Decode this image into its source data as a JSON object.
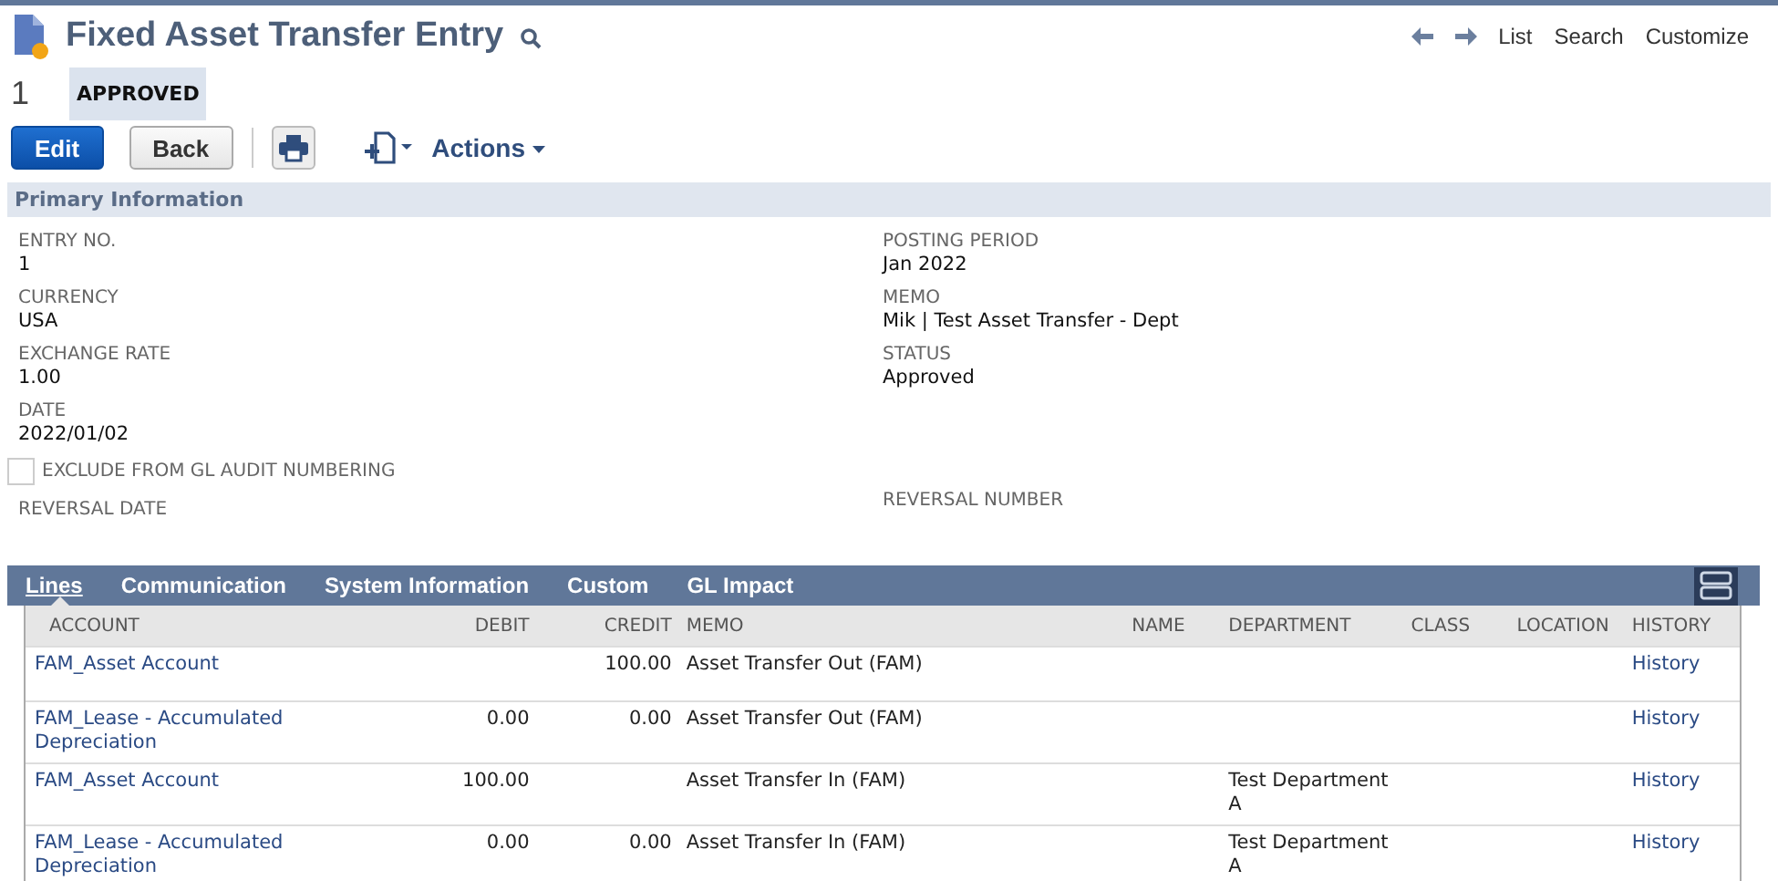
{
  "page": {
    "title": "Fixed Asset Transfer Entry",
    "record_number": "1",
    "status_badge": "APPROVED"
  },
  "nav_links": [
    "List",
    "Search",
    "Customize"
  ],
  "toolbar": {
    "edit": "Edit",
    "back": "Back",
    "actions": "Actions"
  },
  "section": {
    "title": "Primary Information"
  },
  "fields_left": [
    {
      "kind": "field",
      "label": "ENTRY NO.",
      "value": "1"
    },
    {
      "kind": "field",
      "label": "CURRENCY",
      "value": "USA"
    },
    {
      "kind": "field",
      "label": "EXCHANGE RATE",
      "value": "1.00"
    },
    {
      "kind": "field",
      "label": "DATE",
      "value": "2022/01/02"
    },
    {
      "kind": "checkbox",
      "label": "EXCLUDE FROM GL AUDIT NUMBERING",
      "checked": false
    },
    {
      "kind": "field",
      "label": "REVERSAL DATE"
    }
  ],
  "fields_right": [
    {
      "kind": "field",
      "label": "POSTING PERIOD",
      "value": "Jan 2022"
    },
    {
      "kind": "field",
      "label": "MEMO",
      "value": "Mik | Test Asset Transfer - Dept"
    },
    {
      "kind": "field",
      "label": "STATUS",
      "value": "Approved"
    },
    {
      "kind": "spacer"
    },
    {
      "kind": "field",
      "label": "REVERSAL NUMBER"
    }
  ],
  "tabs": [
    {
      "label": "Lines",
      "selected": true
    },
    {
      "label": "Communication",
      "selected": false
    },
    {
      "label": "System Information",
      "selected": false
    },
    {
      "label": "Custom",
      "selected": false
    },
    {
      "label": "GL Impact",
      "selected": false
    }
  ],
  "table": {
    "columns": [
      "ACCOUNT",
      "DEBIT",
      "CREDIT",
      "MEMO",
      "NAME",
      "DEPARTMENT",
      "CLASS",
      "LOCATION",
      "HISTORY"
    ],
    "rows": [
      {
        "account": "FAM_Asset Account",
        "credit": "100.00",
        "memo": "Asset Transfer Out (FAM)",
        "history": "History"
      },
      {
        "account": "FAM_Lease - Accumulated Depreciation",
        "debit": "0.00",
        "credit": "0.00",
        "memo": "Asset Transfer Out (FAM)",
        "history": "History"
      },
      {
        "account": "FAM_Asset Account",
        "debit": "100.00",
        "memo": "Asset Transfer In (FAM)",
        "department": "Test Department A",
        "history": "History"
      },
      {
        "account": "FAM_Lease - Accumulated Depreciation",
        "debit": "0.00",
        "credit": "0.00",
        "memo": "Asset Transfer In (FAM)",
        "department": "Test Department A",
        "history": "History"
      }
    ]
  }
}
